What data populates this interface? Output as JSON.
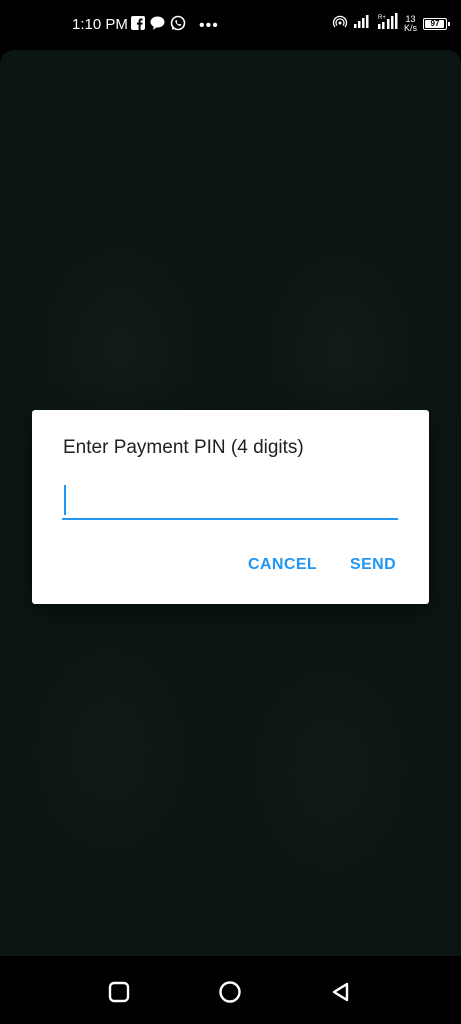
{
  "status_bar": {
    "time": "1:10 PM",
    "more_notifications": "•••",
    "net_speed_value": "13",
    "net_speed_unit": "K/s",
    "battery": "97"
  },
  "dialog": {
    "title": "Enter Payment PIN (4 digits)",
    "pin_value": "",
    "cancel_label": "CANCEL",
    "send_label": "SEND"
  },
  "colors": {
    "accent": "#2196f3",
    "background": "#0b1612"
  },
  "icons": {
    "notifications": [
      "facebook-icon",
      "chat-bubble-icon",
      "whatsapp-icon"
    ],
    "status": [
      "hotspot-icon",
      "signal-icon",
      "signal-4g-icon"
    ],
    "nav": [
      "recents-icon",
      "home-icon",
      "back-icon"
    ]
  }
}
